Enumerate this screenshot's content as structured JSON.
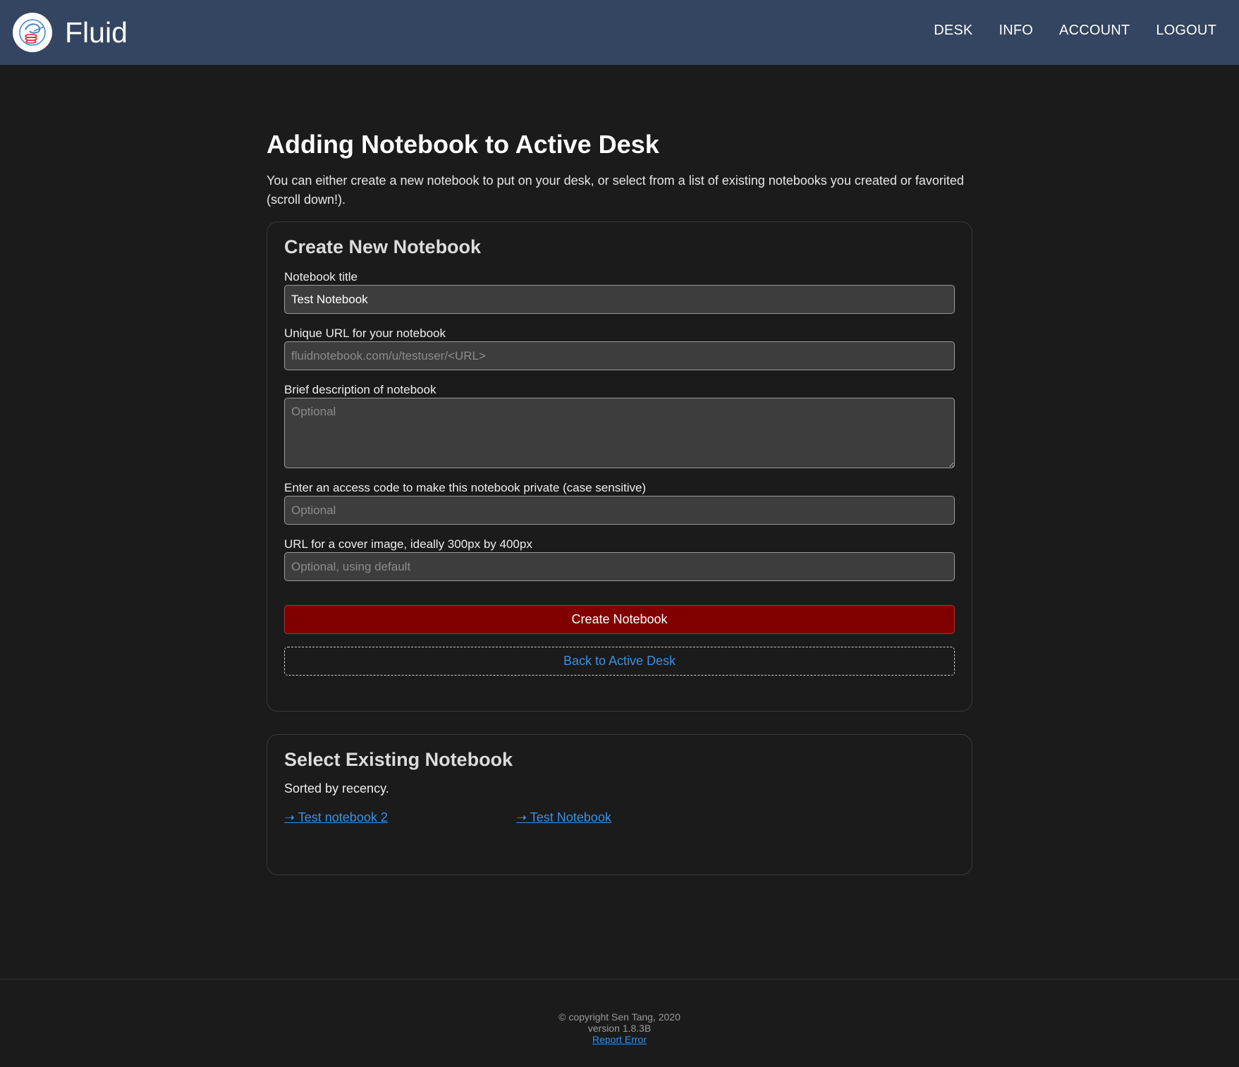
{
  "header": {
    "brand": "Fluid",
    "nav": [
      "DESK",
      "INFO",
      "ACCOUNT",
      "LOGOUT"
    ],
    "logo_icon": "fluid-logo-icon",
    "bg_color": "#334560"
  },
  "page": {
    "title": "Adding Notebook to Active Desk",
    "intro": "You can either create a new notebook to put on your desk, or select from a list of existing notebooks you created or favorited (scroll down!)."
  },
  "create_form": {
    "title": "Create New Notebook",
    "fields": {
      "title": {
        "label": "Notebook title",
        "value": "Test Notebook",
        "placeholder": ""
      },
      "url": {
        "label": "Unique URL for your notebook",
        "value": "",
        "placeholder": "fluidnotebook.com/u/testuser/<URL>"
      },
      "description": {
        "label": "Brief description of notebook",
        "value": "",
        "placeholder": "Optional"
      },
      "access_code": {
        "label": "Enter an access code to make this notebook private (case sensitive)",
        "value": "",
        "placeholder": "Optional"
      },
      "cover_image": {
        "label": "URL for a cover image, ideally 300px by 400px",
        "value": "",
        "placeholder": "Optional, using default"
      }
    },
    "create_button": "Create Notebook",
    "create_button_color": "#800000",
    "back_link": "Back to Active Desk"
  },
  "select_existing": {
    "title": "Select Existing Notebook",
    "note": "Sorted by recency.",
    "notebooks": [
      "➝ Test notebook 2",
      "➝ Test Notebook"
    ]
  },
  "footer": {
    "copyright": "© copyright Sen Tang, 2020",
    "version": "version 1.8.3B",
    "report": "Report Error"
  },
  "colors": {
    "background": "#1b1b1c",
    "link": "#3a8fe0"
  }
}
